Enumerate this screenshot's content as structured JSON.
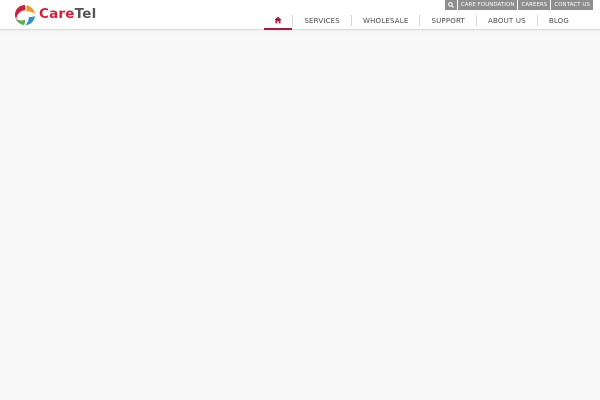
{
  "brand": {
    "name_part1": "Care",
    "name_part2": "Tel",
    "colors": {
      "accent": "#b0173a",
      "logo_red": "#d21f3c",
      "logo_orange": "#f39a1e",
      "logo_green": "#5bb04a",
      "logo_blue": "#2e8fd0"
    }
  },
  "utility_bar": {
    "search_icon": "search-icon",
    "links": [
      "CARE FOUNDATION",
      "CAREERS",
      "CONTACT US"
    ]
  },
  "nav": {
    "home_icon": "home-icon",
    "items": [
      "SERVICES",
      "WHOLESALE",
      "SUPPORT",
      "ABOUT US",
      "BLOG"
    ],
    "active": "home"
  }
}
